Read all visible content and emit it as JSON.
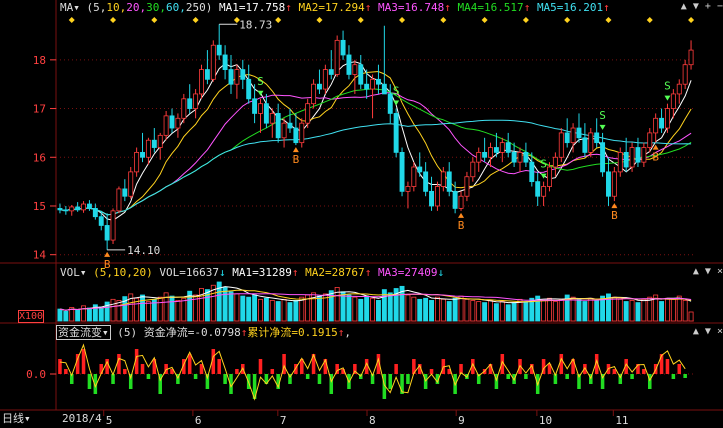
{
  "colors": {
    "bg": "#000000",
    "up": "#ff3c3c",
    "down": "#20d8e8",
    "grid": "#7a1010",
    "ma1": "#ffffff",
    "ma2": "#ffd21e",
    "ma3": "#ff55ff",
    "ma4": "#22dd22",
    "ma5": "#40e0f0",
    "vol_ma1": "#ffffff",
    "vol_ma2": "#ffd21e",
    "vol_ma3": "#ff55ff",
    "flow_pos": "#ff2020",
    "flow_neg": "#22dd22",
    "flow_line": "#ffd21e",
    "b_marker": "#ff8a1e",
    "s_marker": "#55ff55",
    "diamond": "#ffd21e",
    "axis_text": "#ff4040"
  },
  "header": {
    "ind": "MA▾",
    "params_prefix": "(5,",
    "p1": "10,",
    "p2": "20,",
    "p3": "30,",
    "p4": "60,",
    "p5": "250)",
    "ma1": "MA1=17.758",
    "ma2": "MA2=17.294",
    "ma3": "MA3=16.748",
    "ma4": "MA4=16.517",
    "ma5": "MA5=16.201",
    "up_arrow": "↑",
    "down_arrow": "↓"
  },
  "vol_header": {
    "ind": "VOL▾",
    "params": "(5,10,20)",
    "vol": "VOL=16637",
    "ma1": "MA1=31289",
    "ma2": "MA2=28767",
    "ma3": "MA3=27409",
    "unit": "X100"
  },
  "flow_header": {
    "ind": "资金流变▾",
    "params": "(5)",
    "net": "资金净流=-0.0798",
    "cum": "累计净流=0.1915",
    "tail": ","
  },
  "window_controls": {
    "up": "▲",
    "down": "▼",
    "plus": "+",
    "minus": "−",
    "close": "×"
  },
  "footer": {
    "period": "日线▾",
    "year": "2018/4",
    "months": [
      "5",
      "6",
      "7",
      "8",
      "9",
      "10",
      "11"
    ]
  },
  "annotations": {
    "high": "18.73",
    "low": "14.10",
    "b": "B",
    "s": "S"
  },
  "chart_data": [
    {
      "type": "candlestick",
      "title": "",
      "y_ticks": [
        14,
        15,
        16,
        17,
        18
      ],
      "ylim": [
        13.85,
        18.9
      ],
      "ohlc": [
        [
          14.95,
          15.05,
          14.85,
          14.92
        ],
        [
          14.92,
          15.0,
          14.82,
          14.9
        ],
        [
          14.9,
          15.02,
          14.8,
          14.98
        ],
        [
          14.98,
          15.08,
          14.88,
          14.92
        ],
        [
          14.92,
          15.1,
          14.86,
          15.04
        ],
        [
          15.04,
          15.12,
          14.9,
          14.95
        ],
        [
          14.95,
          15.05,
          14.72,
          14.78
        ],
        [
          14.78,
          14.9,
          14.5,
          14.6
        ],
        [
          14.6,
          14.85,
          14.1,
          14.3
        ],
        [
          14.3,
          14.95,
          14.22,
          14.9
        ],
        [
          14.9,
          15.4,
          14.85,
          15.35
        ],
        [
          15.35,
          15.55,
          15.1,
          15.2
        ],
        [
          15.2,
          15.8,
          15.15,
          15.7
        ],
        [
          15.7,
          16.2,
          15.6,
          16.1
        ],
        [
          16.1,
          16.5,
          15.9,
          16.0
        ],
        [
          16.0,
          16.4,
          15.85,
          16.35
        ],
        [
          16.35,
          16.6,
          16.1,
          16.2
        ],
        [
          16.2,
          16.5,
          15.95,
          16.45
        ],
        [
          16.45,
          16.95,
          16.35,
          16.85
        ],
        [
          16.85,
          17.0,
          16.5,
          16.6
        ],
        [
          16.6,
          16.9,
          16.4,
          16.8
        ],
        [
          16.8,
          17.3,
          16.7,
          17.2
        ],
        [
          17.2,
          17.5,
          16.9,
          17.0
        ],
        [
          17.0,
          17.4,
          16.8,
          17.3
        ],
        [
          17.3,
          17.9,
          17.2,
          17.8
        ],
        [
          17.8,
          18.2,
          17.5,
          17.6
        ],
        [
          17.6,
          18.4,
          17.55,
          18.3
        ],
        [
          18.3,
          18.73,
          18.0,
          18.1
        ],
        [
          18.1,
          18.3,
          17.6,
          17.8
        ],
        [
          17.8,
          18.1,
          17.3,
          17.5
        ],
        [
          17.5,
          17.9,
          17.2,
          17.8
        ],
        [
          17.8,
          18.0,
          17.4,
          17.6
        ],
        [
          17.6,
          17.9,
          17.1,
          17.2
        ],
        [
          17.2,
          17.5,
          16.7,
          16.9
        ],
        [
          16.9,
          17.2,
          16.5,
          17.1
        ],
        [
          17.1,
          17.3,
          16.6,
          16.7
        ],
        [
          16.7,
          17.0,
          16.4,
          16.9
        ],
        [
          16.9,
          17.1,
          16.3,
          16.4
        ],
        [
          16.4,
          16.8,
          16.2,
          16.7
        ],
        [
          16.7,
          17.0,
          16.5,
          16.6
        ],
        [
          16.6,
          16.9,
          16.25,
          16.3
        ],
        [
          16.3,
          16.8,
          16.2,
          16.7
        ],
        [
          16.7,
          17.2,
          16.6,
          17.1
        ],
        [
          17.1,
          17.6,
          17.0,
          17.5
        ],
        [
          17.5,
          17.8,
          17.3,
          17.4
        ],
        [
          17.4,
          17.9,
          17.3,
          17.8
        ],
        [
          17.8,
          18.2,
          17.6,
          17.7
        ],
        [
          17.7,
          18.5,
          17.65,
          18.4
        ],
        [
          18.4,
          18.6,
          18.0,
          18.1
        ],
        [
          18.1,
          18.3,
          17.6,
          17.7
        ],
        [
          17.7,
          18.0,
          17.3,
          17.9
        ],
        [
          17.9,
          18.1,
          17.4,
          17.5
        ],
        [
          17.5,
          17.8,
          17.2,
          17.4
        ],
        [
          17.4,
          17.7,
          16.8,
          17.6
        ],
        [
          17.6,
          17.9,
          17.3,
          17.5
        ],
        [
          17.5,
          18.7,
          17.4,
          17.3
        ],
        [
          17.3,
          17.5,
          16.7,
          16.9
        ],
        [
          16.9,
          17.0,
          16.0,
          16.1
        ],
        [
          16.1,
          16.2,
          15.2,
          15.3
        ],
        [
          15.3,
          15.5,
          14.95,
          15.4
        ],
        [
          15.4,
          15.9,
          15.3,
          15.8
        ],
        [
          15.8,
          16.1,
          15.6,
          15.7
        ],
        [
          15.7,
          15.9,
          15.2,
          15.3
        ],
        [
          15.3,
          15.6,
          14.9,
          15.0
        ],
        [
          15.0,
          15.5,
          14.9,
          15.4
        ],
        [
          15.4,
          15.8,
          15.3,
          15.7
        ],
        [
          15.7,
          15.9,
          15.2,
          15.3
        ],
        [
          15.3,
          15.5,
          14.85,
          14.95
        ],
        [
          14.95,
          15.3,
          14.9,
          15.2
        ],
        [
          15.2,
          15.7,
          15.1,
          15.6
        ],
        [
          15.6,
          16.0,
          15.5,
          15.9
        ],
        [
          15.9,
          16.2,
          15.7,
          16.1
        ],
        [
          16.1,
          16.4,
          15.9,
          16.0
        ],
        [
          16.0,
          16.3,
          15.8,
          16.2
        ],
        [
          16.2,
          16.5,
          16.0,
          16.1
        ],
        [
          16.1,
          16.4,
          15.9,
          16.3
        ],
        [
          16.3,
          16.5,
          16.0,
          16.1
        ],
        [
          16.1,
          16.3,
          15.8,
          15.9
        ],
        [
          15.9,
          16.2,
          15.7,
          16.1
        ],
        [
          16.1,
          16.3,
          15.8,
          15.9
        ],
        [
          15.9,
          16.1,
          15.4,
          15.5
        ],
        [
          15.5,
          15.7,
          15.0,
          15.2
        ],
        [
          15.2,
          15.5,
          15.0,
          15.4
        ],
        [
          15.4,
          15.9,
          15.3,
          15.8
        ],
        [
          15.8,
          16.1,
          15.6,
          16.0
        ],
        [
          16.0,
          16.6,
          15.9,
          16.5
        ],
        [
          16.5,
          16.8,
          16.2,
          16.3
        ],
        [
          16.3,
          16.7,
          16.1,
          16.6
        ],
        [
          16.6,
          16.9,
          16.3,
          16.4
        ],
        [
          16.4,
          16.7,
          16.0,
          16.1
        ],
        [
          16.1,
          16.6,
          16.0,
          16.5
        ],
        [
          16.5,
          16.8,
          16.2,
          16.3
        ],
        [
          16.3,
          16.5,
          15.6,
          15.7
        ],
        [
          15.7,
          16.0,
          15.0,
          15.2
        ],
        [
          15.2,
          15.8,
          15.1,
          15.7
        ],
        [
          15.7,
          16.2,
          15.6,
          16.1
        ],
        [
          16.1,
          16.4,
          15.7,
          15.8
        ],
        [
          15.8,
          16.3,
          15.7,
          16.2
        ],
        [
          16.2,
          16.4,
          15.8,
          15.9
        ],
        [
          15.9,
          16.3,
          15.8,
          16.2
        ],
        [
          16.2,
          16.6,
          16.1,
          16.5
        ],
        [
          16.5,
          16.9,
          16.3,
          16.8
        ],
        [
          16.8,
          17.0,
          16.5,
          16.6
        ],
        [
          16.6,
          17.1,
          16.5,
          17.0
        ],
        [
          17.0,
          17.4,
          16.8,
          17.3
        ],
        [
          17.3,
          17.6,
          17.1,
          17.5
        ],
        [
          17.5,
          18.0,
          17.4,
          17.9
        ],
        [
          17.9,
          18.4,
          17.8,
          18.2
        ]
      ],
      "high_label": {
        "i": 27,
        "value": 18.73
      },
      "low_label": {
        "i": 8,
        "value": 14.1
      },
      "buy_signals": [
        8,
        40,
        68,
        94,
        101
      ],
      "sell_signals": [
        34,
        57,
        82,
        92,
        103
      ],
      "ma_series": [
        {
          "name": "MA1",
          "period": 5,
          "value": 17.758
        },
        {
          "name": "MA2",
          "period": 10,
          "value": 17.294
        },
        {
          "name": "MA3",
          "period": 20,
          "value": 16.748
        },
        {
          "name": "MA4",
          "period": 30,
          "value": 16.517
        },
        {
          "name": "MA5",
          "period": 60,
          "value": 16.201
        }
      ]
    },
    {
      "type": "bar",
      "title": "VOL",
      "values": [
        22,
        18,
        25,
        20,
        28,
        24,
        30,
        26,
        35,
        40,
        38,
        45,
        50,
        42,
        48,
        36,
        40,
        44,
        52,
        46,
        38,
        42,
        55,
        48,
        60,
        58,
        66,
        72,
        62,
        54,
        50,
        46,
        44,
        48,
        40,
        42,
        38,
        36,
        40,
        34,
        38,
        44,
        48,
        52,
        46,
        50,
        56,
        62,
        54,
        48,
        44,
        40,
        46,
        42,
        38,
        58,
        52,
        60,
        64,
        48,
        44,
        40,
        42,
        38,
        44,
        40,
        36,
        42,
        46,
        40,
        38,
        36,
        34,
        38,
        32,
        36,
        30,
        34,
        40,
        36,
        42,
        46,
        38,
        42,
        36,
        40,
        48,
        44,
        40,
        36,
        42,
        38,
        46,
        50,
        44,
        40,
        36,
        38,
        34,
        40,
        44,
        48,
        36,
        42,
        40,
        46,
        38,
        16.637
      ],
      "ma": [
        31289,
        28767,
        27409
      ]
    },
    {
      "type": "bar",
      "title": "资金流变",
      "values": [
        0.3,
        0.1,
        -0.2,
        0.4,
        0.5,
        -0.3,
        -0.4,
        0.2,
        0.3,
        -0.2,
        0.4,
        0.1,
        -0.3,
        0.5,
        0.2,
        -0.1,
        0.3,
        -0.4,
        0.2,
        0.1,
        -0.2,
        0.3,
        0.4,
        -0.1,
        0.2,
        -0.3,
        0.5,
        0.3,
        -0.2,
        -0.4,
        0.1,
        0.2,
        -0.3,
        -0.5,
        0.3,
        -0.2,
        0.1,
        -0.3,
        0.4,
        -0.2,
        0.2,
        0.3,
        -0.1,
        0.4,
        -0.2,
        0.3,
        -0.4,
        0.2,
        0.1,
        -0.3,
        0.2,
        -0.1,
        0.3,
        -0.2,
        0.4,
        -0.5,
        -0.3,
        0.2,
        -0.4,
        -0.2,
        0.3,
        0.2,
        -0.3,
        0.1,
        -0.2,
        0.3,
        0.1,
        -0.4,
        0.2,
        -0.1,
        0.3,
        -0.2,
        0.1,
        0.2,
        -0.3,
        0.4,
        -0.1,
        -0.2,
        0.3,
        -0.1,
        0.2,
        -0.4,
        0.3,
        0.2,
        -0.2,
        0.4,
        -0.1,
        0.3,
        -0.3,
        0.2,
        -0.2,
        0.4,
        -0.3,
        0.2,
        0.1,
        -0.2,
        0.3,
        -0.1,
        0.2,
        0.1,
        -0.3,
        0.2,
        0.4,
        0.3,
        -0.1,
        0.2,
        -0.0798
      ],
      "y_ticks": [
        0.0
      ]
    }
  ]
}
